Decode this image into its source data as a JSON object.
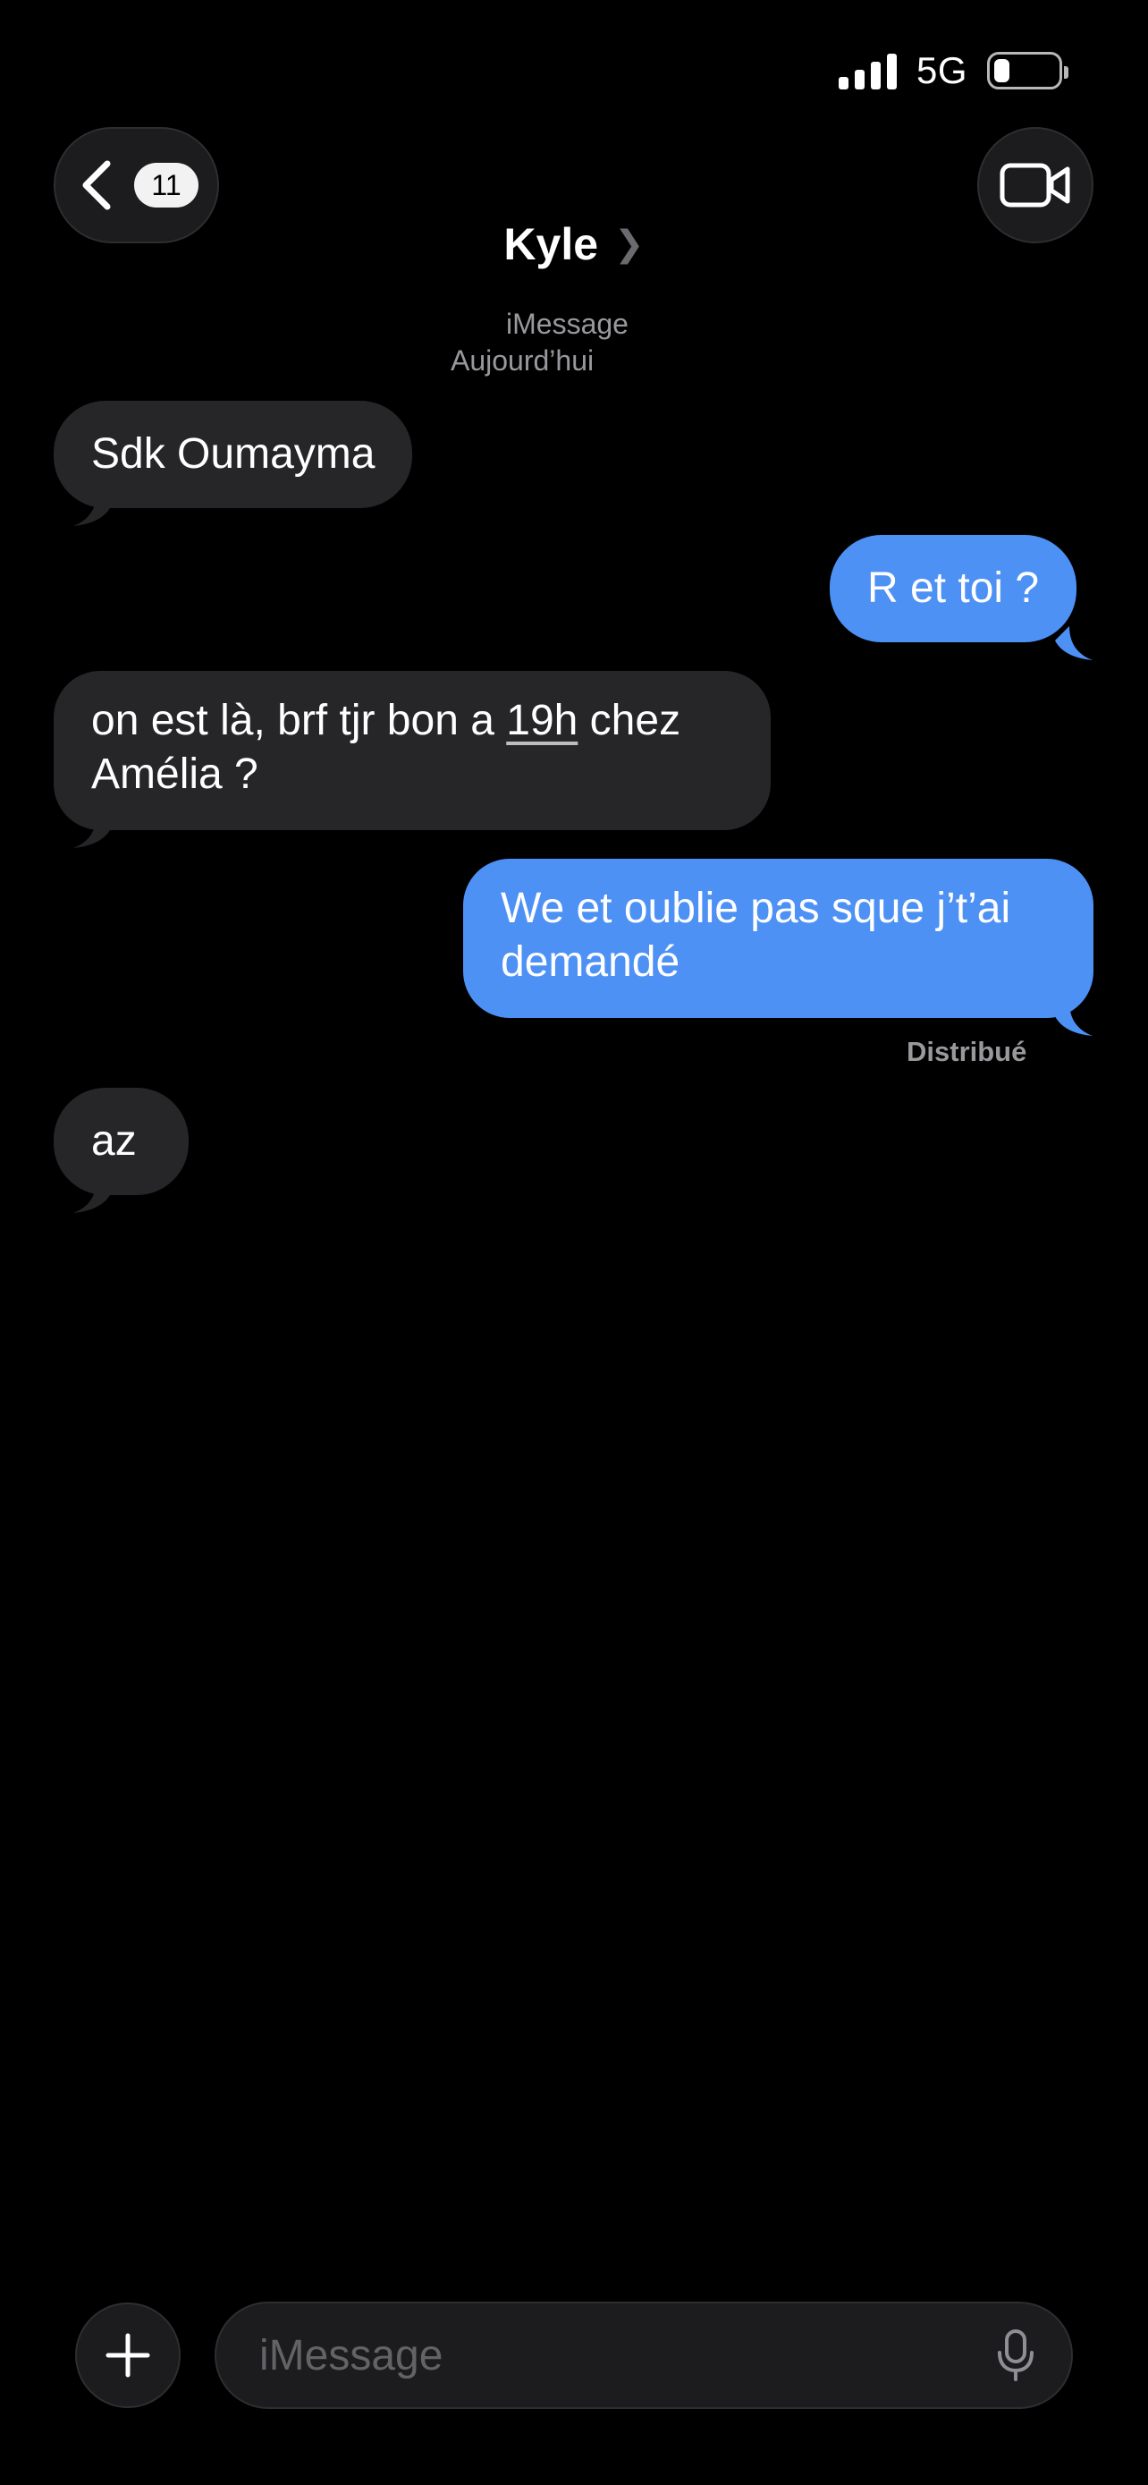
{
  "status_bar": {
    "network": "5G",
    "signal_bars": 4,
    "battery_level_percent": 25
  },
  "nav": {
    "back_badge": "11",
    "contact_name": "Kyle",
    "contact_chevron": "❯"
  },
  "conversation": {
    "service": "iMessage",
    "date": "Aujourd’hui",
    "messages": [
      {
        "direction": "incoming",
        "text": "Sdk Oumayma"
      },
      {
        "direction": "outgoing",
        "text": "R et toi ?"
      },
      {
        "direction": "incoming",
        "text_parts": [
          "on est là, brf tjr bon a ",
          "19h",
          " chez",
          "Amélia ?"
        ]
      },
      {
        "direction": "outgoing",
        "text_lines": [
          "We et oublie pas sque j’t’ai",
          "demandé"
        ]
      },
      {
        "direction": "incoming",
        "text": "az"
      }
    ],
    "delivery_status": "Distribué"
  },
  "composer": {
    "placeholder": "iMessage",
    "value": ""
  },
  "colors": {
    "background": "#000000",
    "incoming_bubble": "#262628",
    "outgoing_bubble": "#4e91f5",
    "secondary_text": "#98989d"
  },
  "icons": {
    "back": "chevron-left-icon",
    "video": "video-camera-icon",
    "add": "plus-icon",
    "dictation": "microphone-icon"
  }
}
